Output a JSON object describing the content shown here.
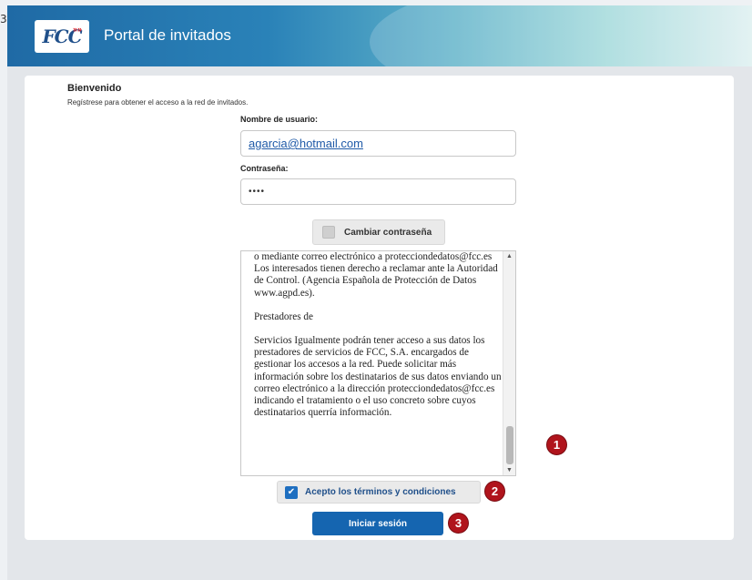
{
  "stray_mark": "3",
  "header": {
    "logo_text": "FCC",
    "logo_arrows": "»»",
    "title": "Portal de invitados"
  },
  "form": {
    "welcome": "Bienvenido",
    "subtitle": "Regístrese para obtener el acceso a la red de invitados.",
    "username_label": "Nombre de usuario:",
    "username_value": "agarcia@hotmail.com",
    "password_label": "Contraseña:",
    "password_value": "••••",
    "change_password_label": "Cambiar contraseña",
    "terms_paragraphs": [
      "o mediante correo electrónico a protecciondedatos@fcc.es Los interesados tienen derecho a reclamar ante la Autoridad de Control. (Agencia Española de Protección de Datos www.agpd.es).",
      "Prestadores de",
      "Servicios Igualmente podrán tener acceso a sus datos los prestadores de servicios de FCC, S.A. encargados de gestionar los accesos a la red. Puede solicitar más información sobre los destinatarios de sus datos enviando un correo electrónico a la dirección protecciondedatos@fcc.es indicando el tratamiento o el uso concreto sobre cuyos destinatarios querría información."
    ],
    "accept_label": "Acepto los términos y condiciones",
    "accept_checked": true,
    "login_label": "Iniciar sesión"
  },
  "badges": [
    "1",
    "2",
    "3"
  ],
  "icons": {
    "checkbox": "check-icon",
    "scroll_up": "scroll-up-icon",
    "scroll_down": "scroll-down-icon"
  },
  "colors": {
    "primary": "#1565b0",
    "badge": "#b0141c"
  }
}
